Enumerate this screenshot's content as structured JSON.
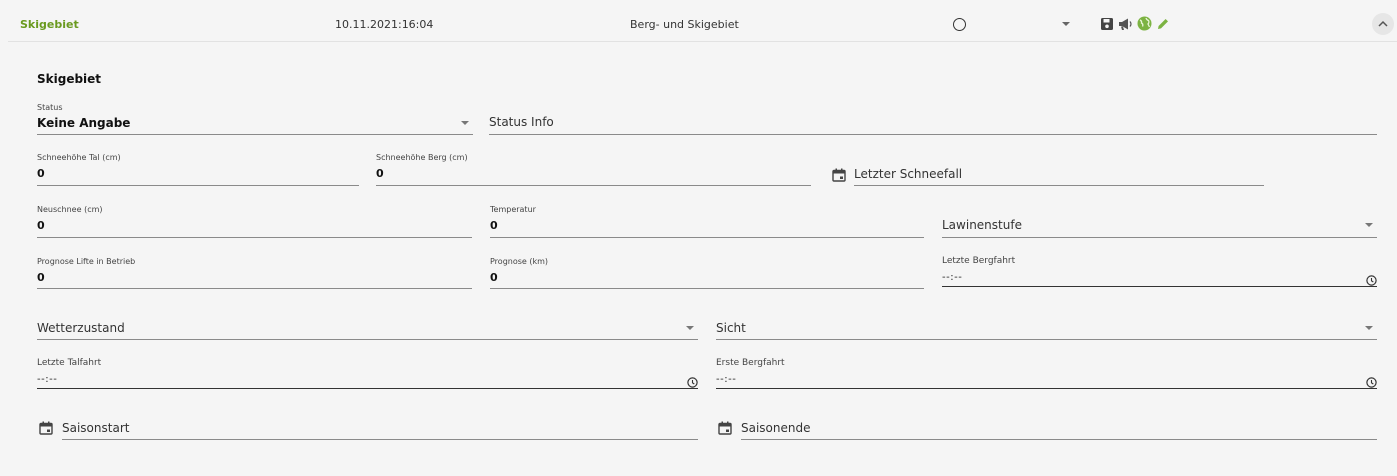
{
  "header": {
    "title": "Skigebiet",
    "datetime": "10.11.2021:16:04",
    "type": "Berg- und Skigebiet",
    "icons": [
      "status-circle-icon",
      "dropdown-caret-icon",
      "save-icon",
      "megaphone-icon",
      "globe-icon",
      "edit-pencil-icon",
      "collapse-chevron-icon"
    ],
    "colors": {
      "title": "#6a9a1f",
      "globe": "#7cb342",
      "pencil": "#7cb342"
    }
  },
  "section": {
    "title": "Skigebiet"
  },
  "fields": {
    "status": {
      "label": "Status",
      "value": "Keine Angabe"
    },
    "status_info": {
      "placeholder": "Status Info"
    },
    "schneehoehe_tal": {
      "label": "Schneehöhe Tal (cm)",
      "value": "0"
    },
    "schneehoehe_berg": {
      "label": "Schneehöhe Berg (cm)",
      "value": "0"
    },
    "letzter_schneefall": {
      "placeholder": "Letzter Schneefall"
    },
    "neuschnee": {
      "label": "Neuschnee (cm)",
      "value": "0"
    },
    "temperatur": {
      "label": "Temperatur",
      "value": "0"
    },
    "lawinenstufe": {
      "placeholder": "Lawinenstufe"
    },
    "prognose_lifte": {
      "label": "Prognose Lifte in Betrieb",
      "value": "0"
    },
    "prognose_km": {
      "label": "Prognose (km)",
      "value": "0"
    },
    "letzte_bergfahrt": {
      "label": "Letzte Bergfahrt",
      "value": "--:--"
    },
    "wetterzustand": {
      "placeholder": "Wetterzustand"
    },
    "sicht": {
      "placeholder": "Sicht"
    },
    "letzte_talfahrt": {
      "label": "Letzte Talfahrt",
      "value": "--:--"
    },
    "erste_bergfahrt": {
      "label": "Erste Bergfahrt",
      "value": "--:--"
    },
    "saisonstart": {
      "placeholder": "Saisonstart"
    },
    "saisonende": {
      "placeholder": "Saisonende"
    }
  }
}
